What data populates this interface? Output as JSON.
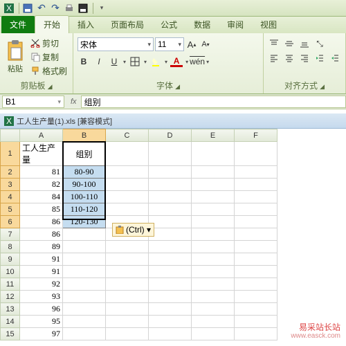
{
  "qat": {
    "undo": "↶",
    "redo": "↷"
  },
  "tabs": {
    "file": "文件",
    "home": "开始",
    "insert": "插入",
    "layout": "页面布局",
    "formulas": "公式",
    "data": "数据",
    "review": "审阅",
    "view": "视图"
  },
  "ribbon": {
    "clipboard": {
      "paste": "粘贴",
      "cut": "剪切",
      "copy": "复制",
      "painter": "格式刷",
      "label": "剪贴板"
    },
    "font": {
      "name": "宋体",
      "size": "11",
      "label": "字体"
    },
    "align": {
      "label": "对齐方式"
    }
  },
  "namebox": "B1",
  "fx": "fx",
  "formula": "组别",
  "workbook": {
    "title": "工人生产量(1).xls  [兼容模式]"
  },
  "cols": [
    "A",
    "B",
    "C",
    "D",
    "E",
    "F"
  ],
  "rowNums": [
    "1",
    "2",
    "3",
    "4",
    "5",
    "6",
    "7",
    "8",
    "9",
    "10",
    "11",
    "12",
    "13",
    "14",
    "15"
  ],
  "cells": {
    "A": [
      "工人生产量",
      "81",
      "82",
      "84",
      "85",
      "86",
      "86",
      "89",
      "91",
      "91",
      "92",
      "93",
      "96",
      "95",
      "97"
    ],
    "B": [
      "组别",
      "80-90",
      "90-100",
      "100-110",
      "110-120",
      "120-130",
      "",
      "",
      "",
      "",
      "",
      "",
      "",
      "",
      ""
    ]
  },
  "pasteTag": "(Ctrl) ▾",
  "watermark": {
    "text": "易采站长站",
    "url": "www.easck.com"
  }
}
